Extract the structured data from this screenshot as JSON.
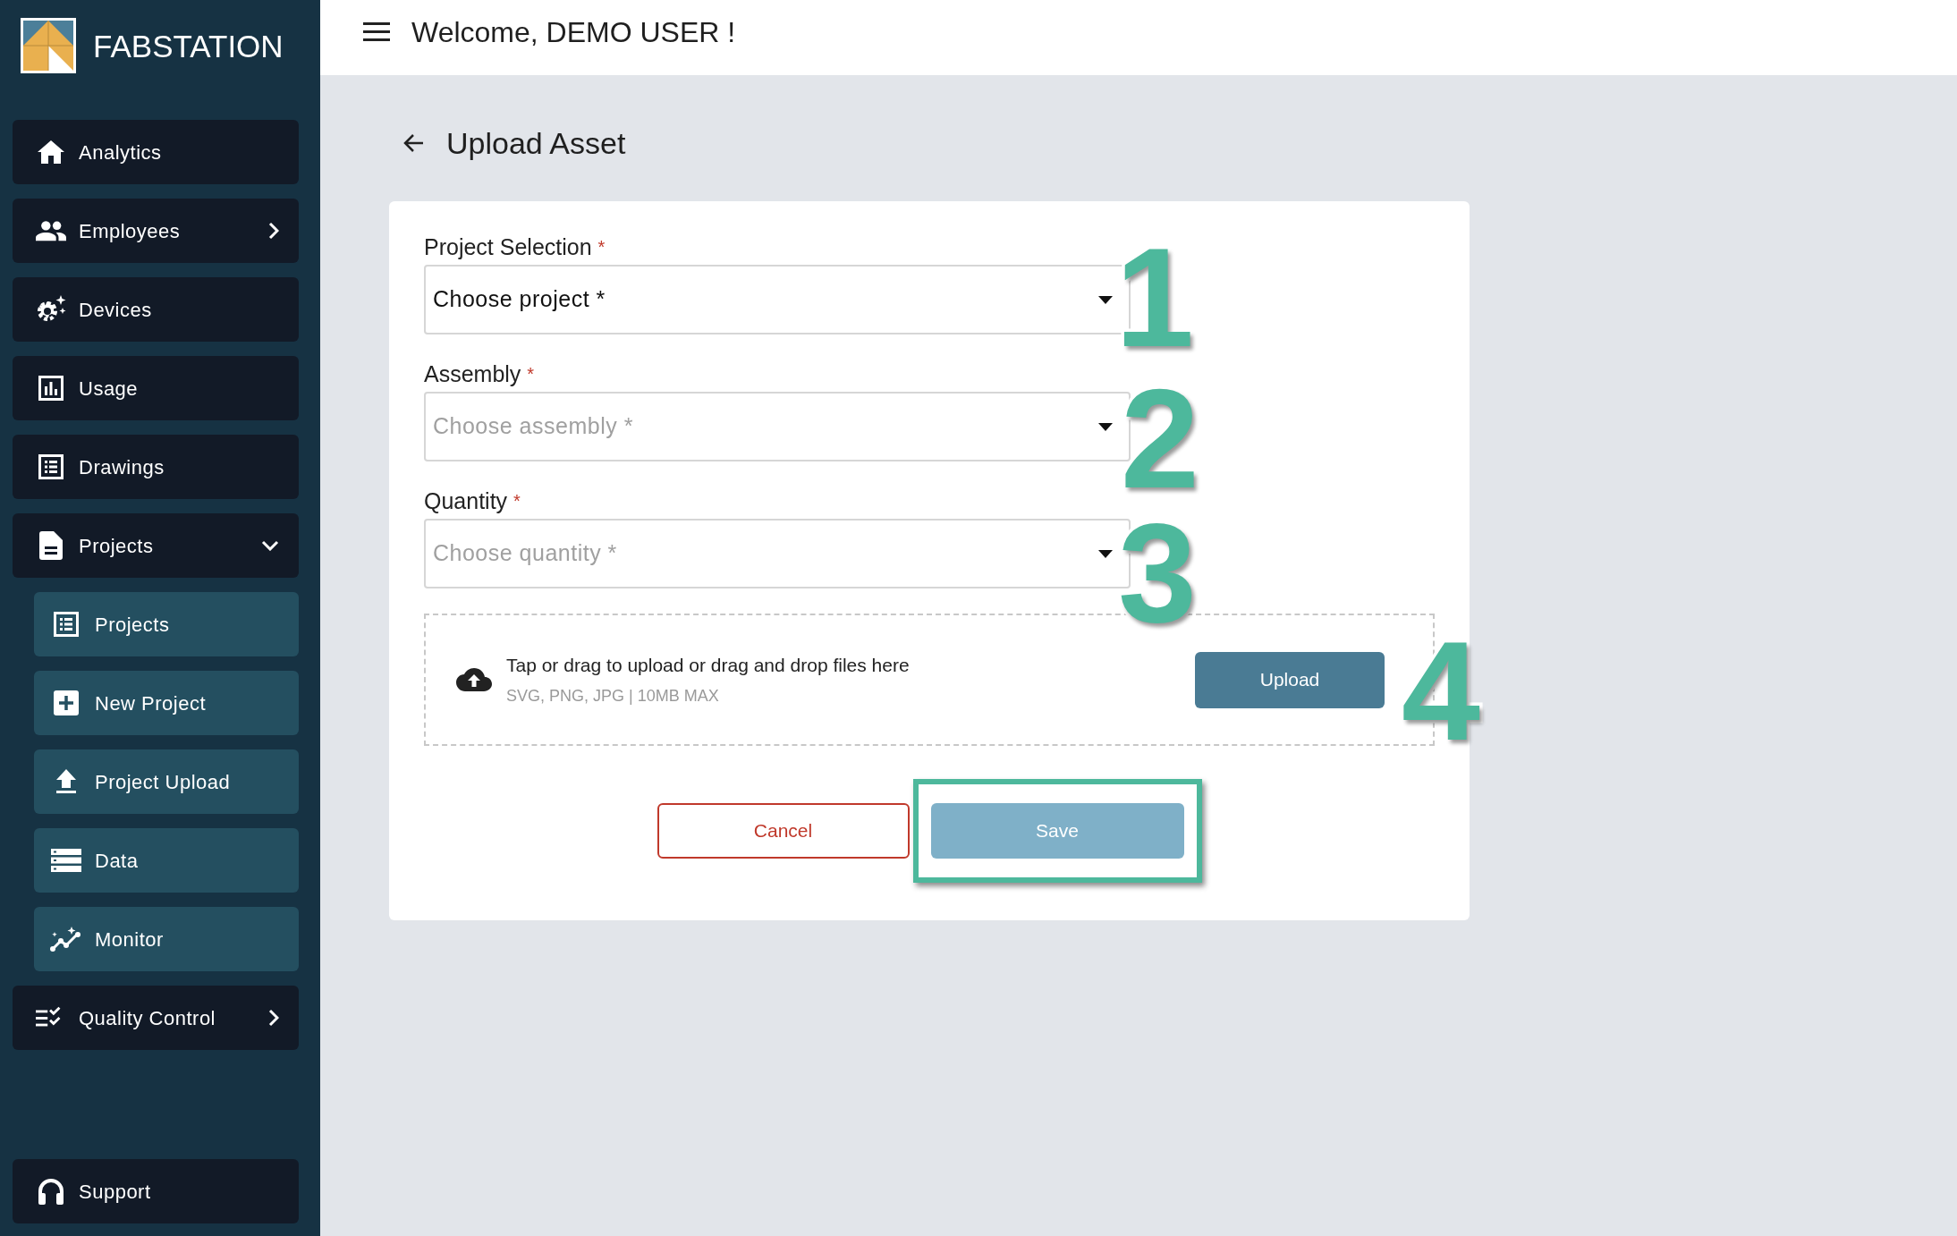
{
  "brand": {
    "name": "FABSTATION"
  },
  "sidebar": {
    "items": [
      {
        "label": "Analytics"
      },
      {
        "label": "Employees",
        "expanded": false
      },
      {
        "label": "Devices"
      },
      {
        "label": "Usage"
      },
      {
        "label": "Drawings"
      },
      {
        "label": "Projects",
        "expanded": true,
        "children": [
          {
            "label": "Projects"
          },
          {
            "label": "New Project"
          },
          {
            "label": "Project Upload"
          },
          {
            "label": "Data"
          },
          {
            "label": "Monitor"
          }
        ]
      },
      {
        "label": "Quality Control",
        "expanded": false
      }
    ],
    "footer_item": {
      "label": "Support"
    }
  },
  "header": {
    "title": "Welcome, DEMO USER !"
  },
  "page": {
    "title": "Upload Asset"
  },
  "form": {
    "fields": [
      {
        "label": "Project Selection",
        "required_mark": "*",
        "placeholder": "Choose project *",
        "disabled": false
      },
      {
        "label": "Assembly",
        "required_mark": "*",
        "placeholder": "Choose assembly *",
        "disabled": true
      },
      {
        "label": "Quantity",
        "required_mark": "*",
        "placeholder": "Choose quantity *",
        "disabled": true
      }
    ],
    "upload": {
      "title": "Tap or drag to upload or drag and drop files here",
      "hint": "SVG, PNG, JPG | 10MB MAX",
      "button": "Upload"
    },
    "cancel": {
      "label": "Cancel"
    },
    "save": {
      "label": "Save",
      "disabled": true,
      "highlighted": true
    }
  },
  "annotations": [
    {
      "label": "1"
    },
    {
      "label": "2"
    },
    {
      "label": "3"
    },
    {
      "label": "4"
    }
  ]
}
